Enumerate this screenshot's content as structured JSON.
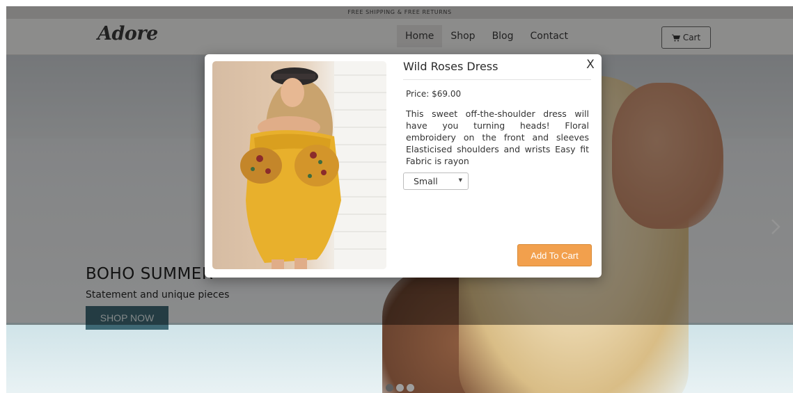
{
  "topbar": {
    "text": "FREE SHIPPING & FREE RETURNS"
  },
  "header": {
    "logo": "Adore",
    "nav": [
      {
        "label": "Home",
        "active": true
      },
      {
        "label": "Shop",
        "active": false
      },
      {
        "label": "Blog",
        "active": false
      },
      {
        "label": "Contact",
        "active": false
      }
    ],
    "cart_label": "Cart",
    "cart_icon": "cart-icon"
  },
  "hero": {
    "title": "BOHO SUMMER",
    "subtitle": "Statement and unique pieces",
    "cta_label": "SHOP NOW",
    "next_icon": "chevron-right-icon",
    "slide_count": 3,
    "active_slide": 1
  },
  "modal": {
    "title": "Wild Roses Dress",
    "close_label": "X",
    "price": "Price: $69.00",
    "description": "This sweet off-the-shoulder dress will have you turning heads! Floral embroidery on the front and sleeves Elasticised shoulders and wrists Easy fit Fabric is rayon",
    "size_selected": "Small",
    "add_to_cart_label": "Add To Cart"
  },
  "colors": {
    "accent_orange": "#f2a04d",
    "shop_now_bg": "#3e6874"
  }
}
